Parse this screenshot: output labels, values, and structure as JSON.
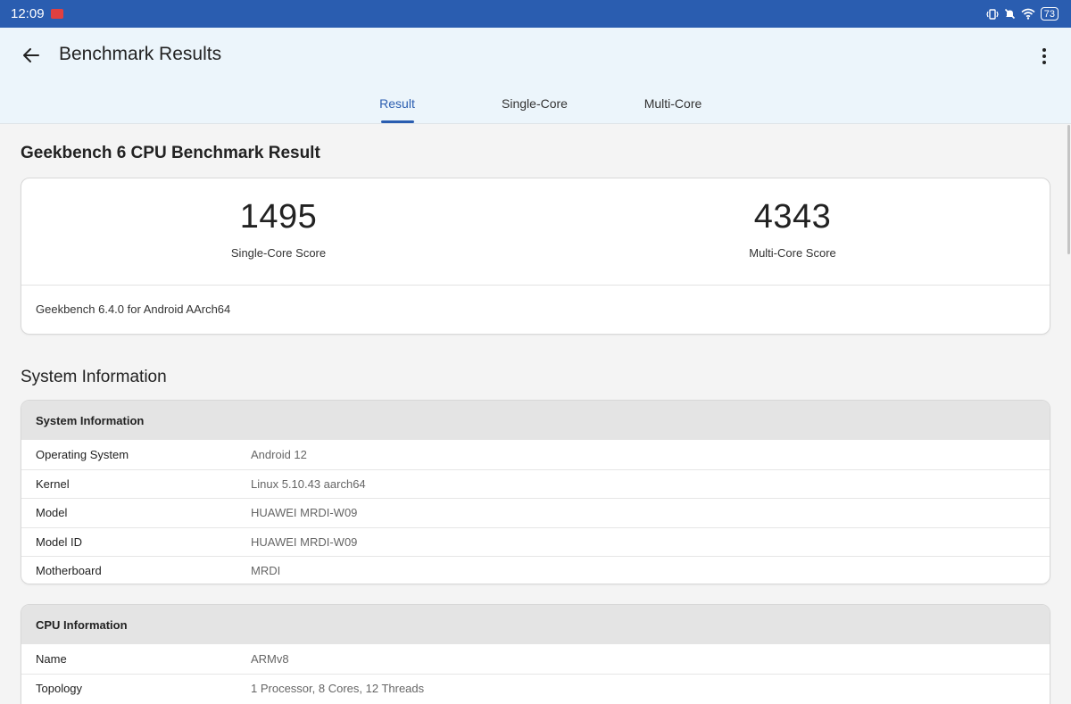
{
  "status_bar": {
    "time": "12:09",
    "battery": "73",
    "icons": [
      "notification-badge",
      "vibrate-icon",
      "mute-icon",
      "wifi-icon",
      "battery-icon"
    ]
  },
  "app_bar": {
    "title": "Benchmark Results",
    "tabs": [
      {
        "label": "Result",
        "active": true
      },
      {
        "label": "Single-Core",
        "active": false
      },
      {
        "label": "Multi-Core",
        "active": false
      }
    ]
  },
  "benchmark": {
    "heading": "Geekbench 6 CPU Benchmark Result",
    "single_core_score": "1495",
    "single_core_label": "Single-Core Score",
    "multi_core_score": "4343",
    "multi_core_label": "Multi-Core Score",
    "version": "Geekbench 6.4.0 for Android AArch64"
  },
  "system_information": {
    "heading": "System Information",
    "table_title": "System Information",
    "rows": [
      {
        "key": "Operating System",
        "value": "Android 12"
      },
      {
        "key": "Kernel",
        "value": "Linux 5.10.43 aarch64"
      },
      {
        "key": "Model",
        "value": "HUAWEI MRDI-W09"
      },
      {
        "key": "Model ID",
        "value": "HUAWEI MRDI-W09"
      },
      {
        "key": "Motherboard",
        "value": "MRDI"
      }
    ]
  },
  "cpu_information": {
    "table_title": "CPU Information",
    "rows": [
      {
        "key": "Name",
        "value": "ARMv8"
      },
      {
        "key": "Topology",
        "value": "1 Processor, 8 Cores, 12 Threads"
      }
    ]
  },
  "colors": {
    "status_bar": "#2a5db0",
    "accent": "#2a5db0",
    "app_bar_bg": "#ecf5fb",
    "page_bg": "#f4f4f4",
    "table_header_bg": "#e4e4e4"
  }
}
